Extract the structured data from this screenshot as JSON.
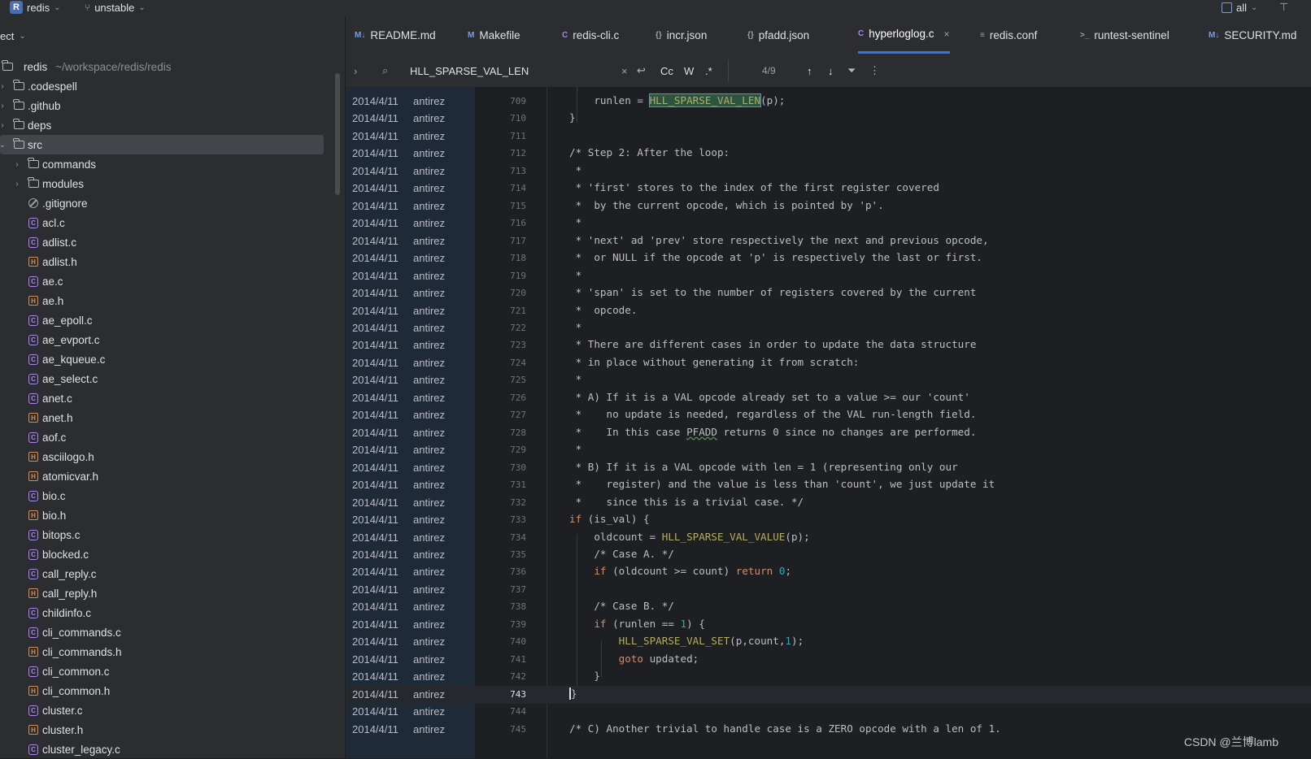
{
  "topbar": {
    "project_letter": "R",
    "project_name": "redis",
    "branch": "unstable",
    "scope": "all"
  },
  "sidebar": {
    "header": "ect",
    "root_name": "redis",
    "root_path": "~/workspace/redis/redis",
    "items": [
      {
        "name": ".codespell",
        "kind": "folder"
      },
      {
        "name": ".github",
        "kind": "folder"
      },
      {
        "name": "deps",
        "kind": "folder"
      },
      {
        "name": "src",
        "kind": "folder"
      },
      {
        "name": "commands",
        "kind": "folder"
      },
      {
        "name": "modules",
        "kind": "folder"
      },
      {
        "name": ".gitignore",
        "kind": "ignore"
      },
      {
        "name": "acl.c",
        "kind": "c"
      },
      {
        "name": "adlist.c",
        "kind": "c"
      },
      {
        "name": "adlist.h",
        "kind": "h"
      },
      {
        "name": "ae.c",
        "kind": "c"
      },
      {
        "name": "ae.h",
        "kind": "h"
      },
      {
        "name": "ae_epoll.c",
        "kind": "c"
      },
      {
        "name": "ae_evport.c",
        "kind": "c"
      },
      {
        "name": "ae_kqueue.c",
        "kind": "c"
      },
      {
        "name": "ae_select.c",
        "kind": "c"
      },
      {
        "name": "anet.c",
        "kind": "c"
      },
      {
        "name": "anet.h",
        "kind": "h"
      },
      {
        "name": "aof.c",
        "kind": "c"
      },
      {
        "name": "asciilogo.h",
        "kind": "h"
      },
      {
        "name": "atomicvar.h",
        "kind": "h"
      },
      {
        "name": "bio.c",
        "kind": "c"
      },
      {
        "name": "bio.h",
        "kind": "h"
      },
      {
        "name": "bitops.c",
        "kind": "c"
      },
      {
        "name": "blocked.c",
        "kind": "c"
      },
      {
        "name": "call_reply.c",
        "kind": "c"
      },
      {
        "name": "call_reply.h",
        "kind": "h"
      },
      {
        "name": "childinfo.c",
        "kind": "c"
      },
      {
        "name": "cli_commands.c",
        "kind": "c"
      },
      {
        "name": "cli_commands.h",
        "kind": "h"
      },
      {
        "name": "cli_common.c",
        "kind": "c"
      },
      {
        "name": "cli_common.h",
        "kind": "h"
      },
      {
        "name": "cluster.c",
        "kind": "c"
      },
      {
        "name": "cluster.h",
        "kind": "h"
      },
      {
        "name": "cluster_legacy.c",
        "kind": "c"
      }
    ]
  },
  "tabs": [
    {
      "label": "README.md",
      "icon": "M↓"
    },
    {
      "label": "Makefile",
      "icon": "M"
    },
    {
      "label": "redis-cli.c",
      "icon": "C"
    },
    {
      "label": "incr.json",
      "icon": "{}"
    },
    {
      "label": "pfadd.json",
      "icon": "{}"
    },
    {
      "label": "hyperloglog.c",
      "icon": "C",
      "active": true
    },
    {
      "label": "redis.conf",
      "icon": "≡"
    },
    {
      "label": "runtest-sentinel",
      "icon": ">_"
    },
    {
      "label": "SECURITY.md",
      "icon": "M↓"
    }
  ],
  "find": {
    "query": "HLL_SPARSE_VAL_LEN",
    "case_label": "Cc",
    "word_label": "W",
    "regex_label": ".*",
    "match_count": "4/9"
  },
  "annotation": {
    "date": "2014/4/11",
    "author": "antirez"
  },
  "editor": {
    "current_line": 743,
    "lines": [
      {
        "n": "709",
        "html": "    runlen = <span class=\"hit\">HLL_SPARSE_VAL_LEN</span>(p);"
      },
      {
        "n": "710",
        "html": "}"
      },
      {
        "n": "711",
        "html": ""
      },
      {
        "n": "712",
        "html": "<span class=\"cmt\">/* Step 2: After the loop:</span>"
      },
      {
        "n": "713",
        "html": "<span class=\"cmt\"> *</span>"
      },
      {
        "n": "714",
        "html": "<span class=\"cmt\"> * 'first' stores to the index of the first register covered</span>"
      },
      {
        "n": "715",
        "html": "<span class=\"cmt\"> *  by the current opcode, which is pointed by 'p'.</span>"
      },
      {
        "n": "716",
        "html": "<span class=\"cmt\"> *</span>"
      },
      {
        "n": "717",
        "html": "<span class=\"cmt\"> * 'next' ad 'prev' store respectively the next and previous opcode,</span>"
      },
      {
        "n": "718",
        "html": "<span class=\"cmt\"> *  or NULL if the opcode at 'p' is respectively the last or first.</span>"
      },
      {
        "n": "719",
        "html": "<span class=\"cmt\"> *</span>"
      },
      {
        "n": "720",
        "html": "<span class=\"cmt\"> * 'span' is set to the number of registers covered by the current</span>"
      },
      {
        "n": "721",
        "html": "<span class=\"cmt\"> *  opcode.</span>"
      },
      {
        "n": "722",
        "html": "<span class=\"cmt\"> *</span>"
      },
      {
        "n": "723",
        "html": "<span class=\"cmt\"> * There are different cases in order to update the data structure</span>"
      },
      {
        "n": "724",
        "html": "<span class=\"cmt\"> * in place without generating it from scratch:</span>"
      },
      {
        "n": "725",
        "html": "<span class=\"cmt\"> *</span>"
      },
      {
        "n": "726",
        "html": "<span class=\"cmt\"> * A) If it is a VAL opcode already set to a value &gt;= our 'count'</span>"
      },
      {
        "n": "727",
        "html": "<span class=\"cmt\"> *    no update is needed, regardless of the VAL run-length field.</span>"
      },
      {
        "n": "728",
        "html": "<span class=\"cmt\"> *    In this case <span class=\"ul\">PFADD</span> returns 0 since no changes are performed.</span>"
      },
      {
        "n": "729",
        "html": "<span class=\"cmt\"> *</span>"
      },
      {
        "n": "730",
        "html": "<span class=\"cmt\"> * B) If it is a VAL opcode with len = 1 (representing only our</span>"
      },
      {
        "n": "731",
        "html": "<span class=\"cmt\"> *    register) and the value is less than 'count', we just update it</span>"
      },
      {
        "n": "732",
        "html": "<span class=\"cmt\"> *    since this is a trivial case. */</span>"
      },
      {
        "n": "733",
        "html": "<span class=\"kw\">if</span> (is_val) {"
      },
      {
        "n": "734",
        "html": "    oldcount = <span class=\"mac\">HLL_SPARSE_VAL_VALUE</span>(p);"
      },
      {
        "n": "735",
        "html": "    <span class=\"cmt\">/* Case A. */</span>"
      },
      {
        "n": "736",
        "html": "    <span class=\"kw\">if</span> (oldcount &gt;= count) <span class=\"kw\">return</span> <span class=\"num\">0</span>;"
      },
      {
        "n": "737",
        "html": ""
      },
      {
        "n": "738",
        "html": "    <span class=\"cmt\">/* Case B. */</span>"
      },
      {
        "n": "739",
        "html": "    <span class=\"kw\">if</span> (runlen == <span class=\"num\">1</span>) {"
      },
      {
        "n": "740",
        "html": "        <span class=\"mac\">HLL_SPARSE_VAL_SET</span>(p,count,<span class=\"num\">1</span>);"
      },
      {
        "n": "741",
        "html": "        <span class=\"kw\">goto</span> updated;"
      },
      {
        "n": "742",
        "html": "    }"
      },
      {
        "n": "743",
        "html": "<span class=\"caret\">}</span>"
      },
      {
        "n": "744",
        "html": ""
      },
      {
        "n": "745",
        "html": "<span class=\"cmt\">/* C) Another trivial to handle case is a ZERO opcode with a len of 1.</span>"
      }
    ]
  },
  "watermark": "CSDN @兰博lamb"
}
